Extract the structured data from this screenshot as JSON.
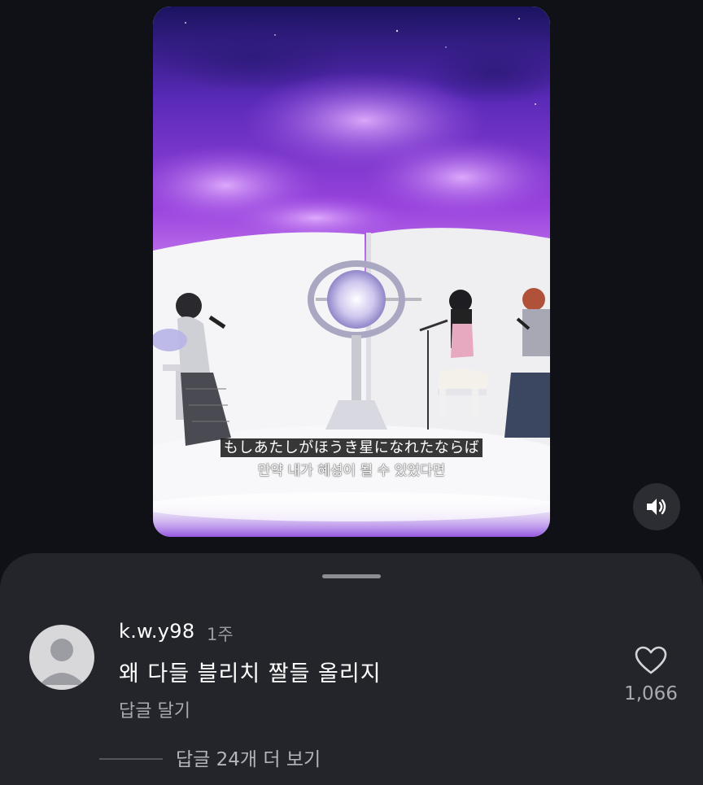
{
  "video": {
    "subtitle_japanese": "もしあたしがほうき星になれたならば",
    "subtitle_korean": "만약 내가 혜성이 될 수 있었다면",
    "mute_button_icon": "speaker-icon"
  },
  "comment": {
    "username": "k.w.y98",
    "time": "1주",
    "text": "왜 다들 블리치 짤들 올리지",
    "reply_label": "답글 달기",
    "like_count": "1,066",
    "like_icon": "heart-outline-icon",
    "avatar_icon": "default-avatar-icon",
    "view_replies_label": "답글 24개 더 보기"
  },
  "colors": {
    "background": "#101116",
    "sheet": "#24252b",
    "sky_purple": "#7b2fd0",
    "muted_text": "#a9aaaf"
  }
}
